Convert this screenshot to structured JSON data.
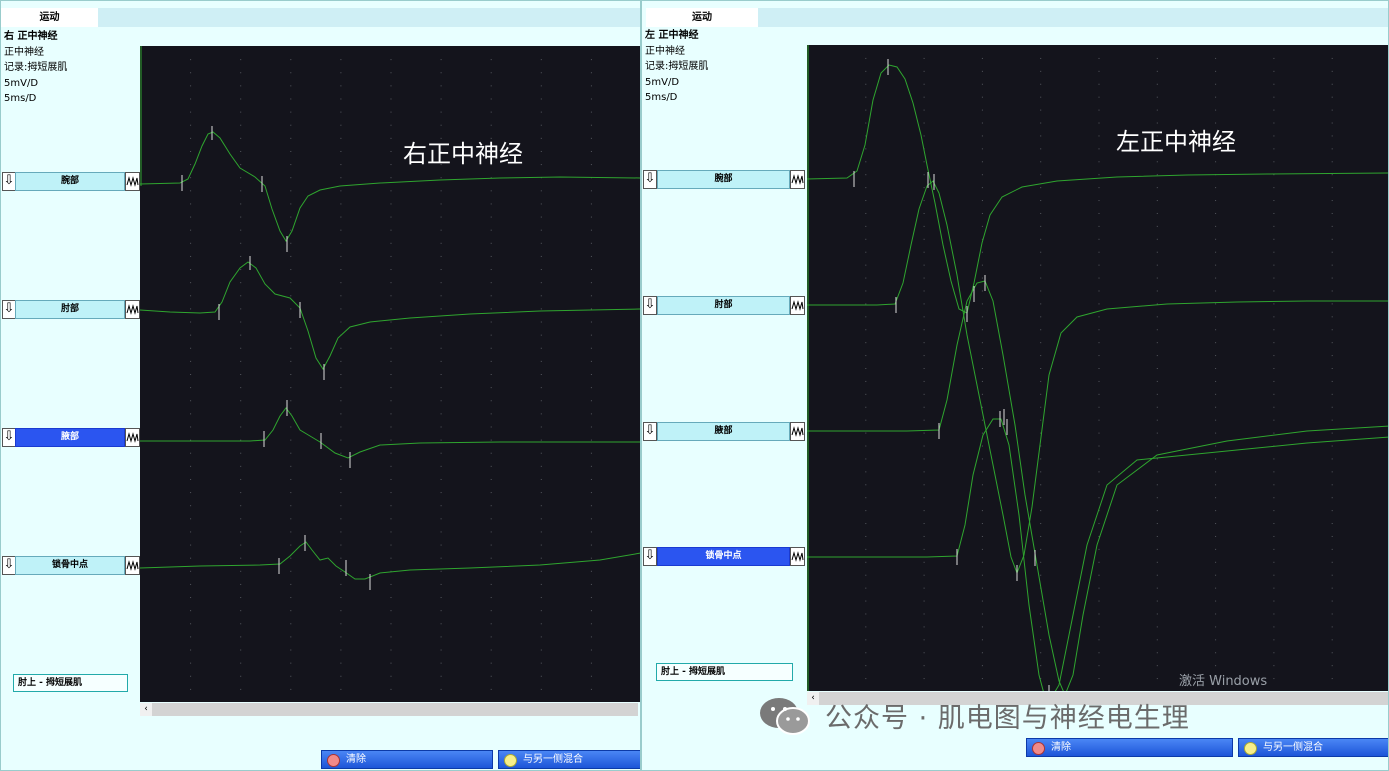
{
  "left": {
    "tab_label": "运动",
    "info": {
      "side_title": "右 正中神经",
      "nerve": "正中神经",
      "record": "记录:拇短展肌",
      "sensitivity": "5mV/D",
      "sweep": "5ms/D"
    },
    "overlay_title": "右正中神经",
    "sites": [
      "腕部",
      "肘部",
      "腋部",
      "锁骨中点"
    ],
    "selected_site": 2,
    "segment_label": "肘上 - 拇短展肌",
    "buttons": {
      "clear": "清除",
      "mix": "与另一侧混合"
    }
  },
  "right": {
    "tab_label": "运动",
    "info": {
      "side_title": "左 正中神经",
      "nerve": "正中神经",
      "record": "记录:拇短展肌",
      "sensitivity": "5mV/D",
      "sweep": "5ms/D"
    },
    "overlay_title": "左正中神经",
    "sites": [
      "腕部",
      "肘部",
      "腋部",
      "锁骨中点"
    ],
    "selected_site": 3,
    "segment_label": "肘上 - 拇短展肌",
    "buttons": {
      "clear": "清除",
      "mix": "与另一侧混合"
    },
    "activate_text": "激活 Windows"
  },
  "watermark": "公众号 · 肌电图与神经电生理",
  "colors": {
    "trace": "#2fa52f",
    "plot_bg": "#14141c",
    "site_bg": "#bff2f8",
    "site_selected": "#2b55f0",
    "panel_bg": "#e8ffff"
  },
  "icons": {
    "stim_button": "down-arrow-icon",
    "wave_button": "waveform-icon",
    "clear_dot": "red-dot-icon",
    "mix_dot": "yellow-dot-icon",
    "wechat": "wechat-icon"
  }
}
